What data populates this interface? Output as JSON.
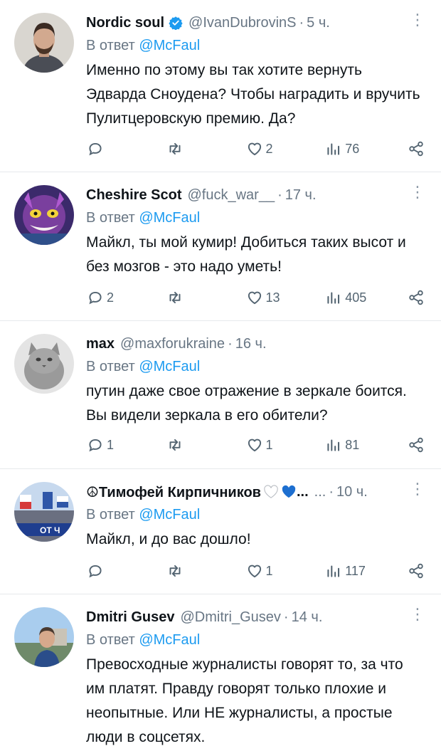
{
  "tweets": [
    {
      "name": "Nordic soul",
      "verified": true,
      "handle": "@IvanDubrovinS",
      "time": "5 ч.",
      "reply_prefix": "В ответ ",
      "reply_to": "@McFaul",
      "text": "Именно по этому вы так хотите вернуть Эдварда Сноудена? Чтобы наградить и вручить Пулитцеровскую премию. Да?",
      "replies": "",
      "retweets": "",
      "likes": "2",
      "views": "76"
    },
    {
      "name": "Cheshire Scot",
      "verified": false,
      "handle": "@fuck_war__",
      "time": "17 ч.",
      "reply_prefix": "В ответ ",
      "reply_to": "@McFaul",
      "text": "Майкл, ты мой кумир! Добиться таких высот и без мозгов - это надо уметь!",
      "replies": "2",
      "retweets": "",
      "likes": "13",
      "views": "405"
    },
    {
      "name": "max",
      "verified": false,
      "handle": "@maxforukraine",
      "time": "16 ч.",
      "reply_prefix": "В ответ ",
      "reply_to": "@McFaul",
      "text": "путин даже свое отражение в зеркале боится. Вы видели зеркала в его обители?",
      "replies": "1",
      "retweets": "",
      "likes": "1",
      "views": "81"
    },
    {
      "name": "☮Тимофей Кирпичников",
      "name_suffix": "...",
      "verified": false,
      "handle": "...",
      "time": "10 ч.",
      "reply_prefix": "В ответ ",
      "reply_to": "@McFaul",
      "text": "Майкл, и до вас дошло!",
      "replies": "",
      "retweets": "",
      "likes": "1",
      "views": "117"
    },
    {
      "name": "Dmitri Gusev",
      "verified": false,
      "handle": "@Dmitri_Gusev",
      "time": "14 ч.",
      "reply_prefix": "В ответ ",
      "reply_to": "@McFaul",
      "text": "Превосходные журналисты говорят то, за что им платят. Правду говорят только плохие и неопытные. Или НЕ журналисты, а простые люди в соцсетях.",
      "replies": "",
      "retweets": "",
      "likes": "",
      "views": ""
    }
  ],
  "colors": {
    "accent": "#1d9bf0",
    "secondary_text": "#687684",
    "divider": "#e6e9ec",
    "verified_badge": "#1d9bf0",
    "white_heart": "#ffffff",
    "blue_heart": "#1d6fd0"
  },
  "icons": [
    "verified-badge-icon",
    "more-options-icon",
    "reply-icon",
    "retweet-icon",
    "like-icon",
    "views-icon",
    "share-icon",
    "white-heart-icon",
    "blue-heart-icon"
  ]
}
